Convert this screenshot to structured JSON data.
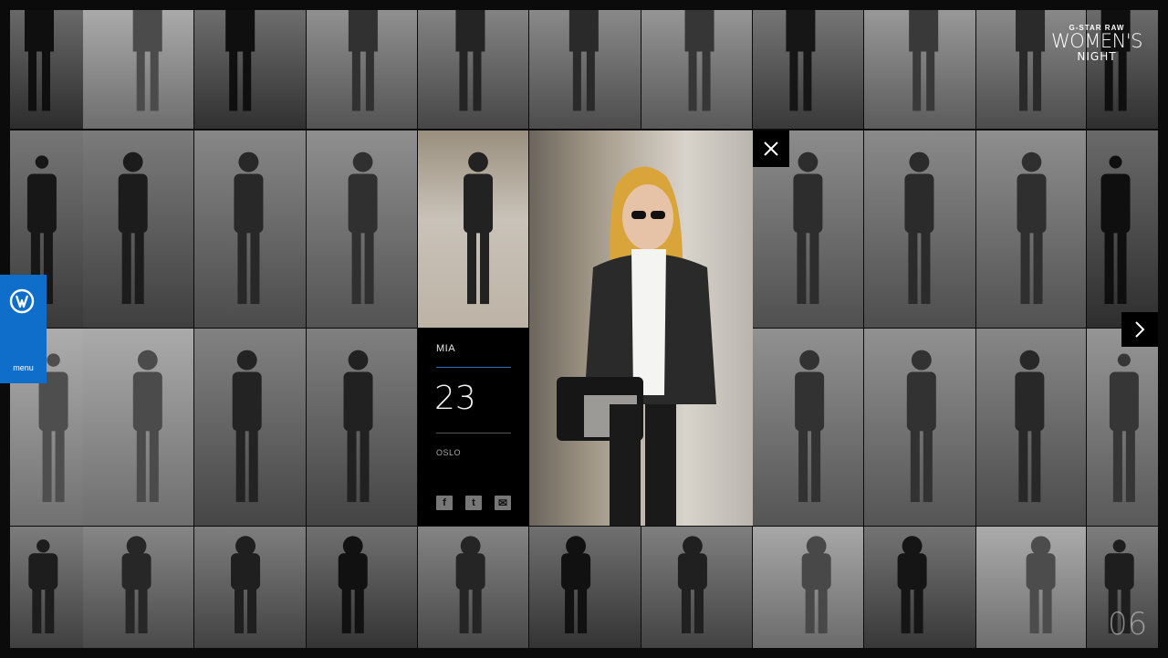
{
  "brand": {
    "maker": "G-STAR RAW",
    "title": "WOMEN'S",
    "subtitle": "NIGHT"
  },
  "menu": {
    "label": "menu",
    "icon": "g-star-logo-icon",
    "color": "#0f6eca"
  },
  "profile": {
    "name": "MIA",
    "age": "23",
    "city": "OSLO"
  },
  "share": [
    {
      "icon": "facebook-icon",
      "glyph": "f"
    },
    {
      "icon": "twitter-icon",
      "glyph": "t"
    },
    {
      "icon": "email-icon",
      "glyph": "✉"
    }
  ],
  "controls": {
    "close_icon": "close-icon",
    "next_icon": "chevron-right-icon"
  },
  "page_number": "06",
  "accent": "#2d6fbf"
}
